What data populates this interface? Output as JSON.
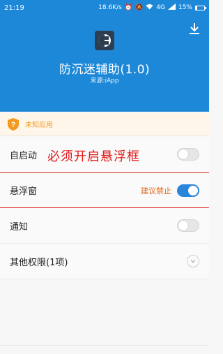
{
  "status_bar": {
    "time": "21:19",
    "net_speed": "18.6K/s",
    "network": "4G",
    "battery": "15%"
  },
  "header": {
    "app_name": "防沉迷辅助(1.0)",
    "source": "来源:iApp",
    "download_icon": "download-icon"
  },
  "warning": {
    "text": "未知应用",
    "icon": "shield-icon",
    "color": "#f39a1e"
  },
  "permissions": [
    {
      "label": "自启动",
      "enabled": false
    },
    {
      "label": "悬浮窗",
      "enabled": true,
      "note": "建议禁止"
    },
    {
      "label": "通知",
      "enabled": false
    },
    {
      "label": "其他权限(1项)",
      "expandable": true
    }
  ],
  "annotation": "必须开启悬浮框",
  "colors": {
    "header_bg": "#1e88d8",
    "toggle_on": "#2a86db",
    "annotation": "#e01919",
    "recommend": "#e2661a"
  }
}
